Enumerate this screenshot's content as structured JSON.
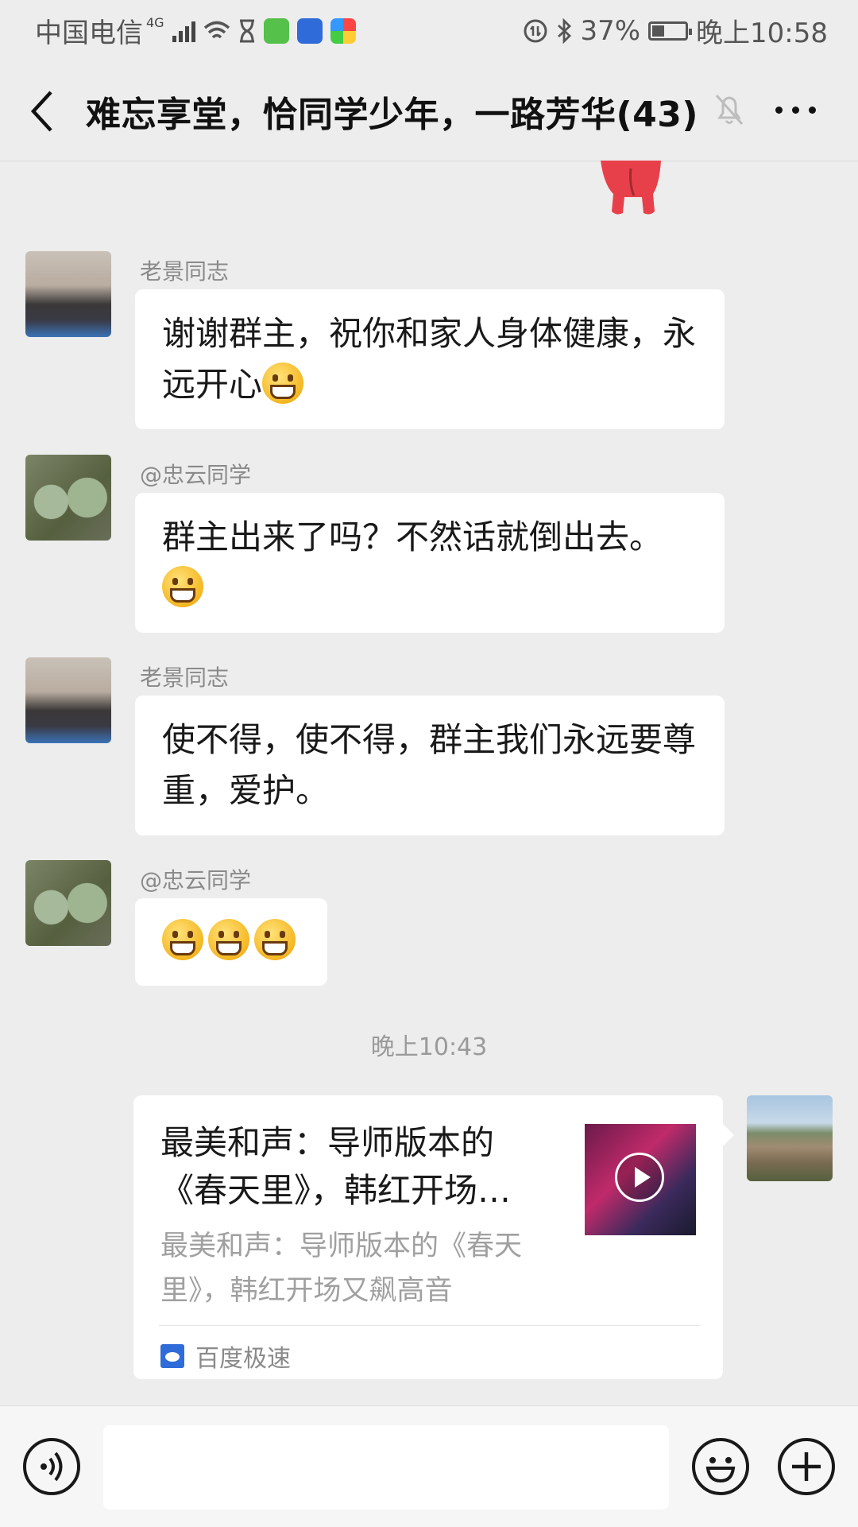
{
  "status_bar": {
    "carrier": "中国电信",
    "network": "4G",
    "battery": "37%",
    "battery_level": 0.37,
    "time": "晚上10:58"
  },
  "header": {
    "title": "难忘享堂，恰同学少年，一路芳华(43)"
  },
  "messages": [
    {
      "sender": "老景同志",
      "text": "谢谢群主，祝你和家人身体健康，永远开心",
      "emoji_count": 1
    },
    {
      "sender": "@忠云同学",
      "text": "群主出来了吗？不然话就倒出去。",
      "emoji_count": 1
    },
    {
      "sender": "老景同志",
      "text": "使不得，使不得，群主我们永远要尊重，爱护。",
      "emoji_count": 0
    },
    {
      "sender": "@忠云同学",
      "text": "",
      "emoji_count": 3
    }
  ],
  "timestamp": "晚上10:43",
  "link_card": {
    "title": "最美和声：导师版本的《春天里》，韩红开场…",
    "description": "最美和声：导师版本的《春天里》，韩红开场又飙高音",
    "source": "百度极速"
  },
  "colors": {
    "background": "#ededed",
    "bubble": "#ffffff",
    "text": "#191919"
  }
}
